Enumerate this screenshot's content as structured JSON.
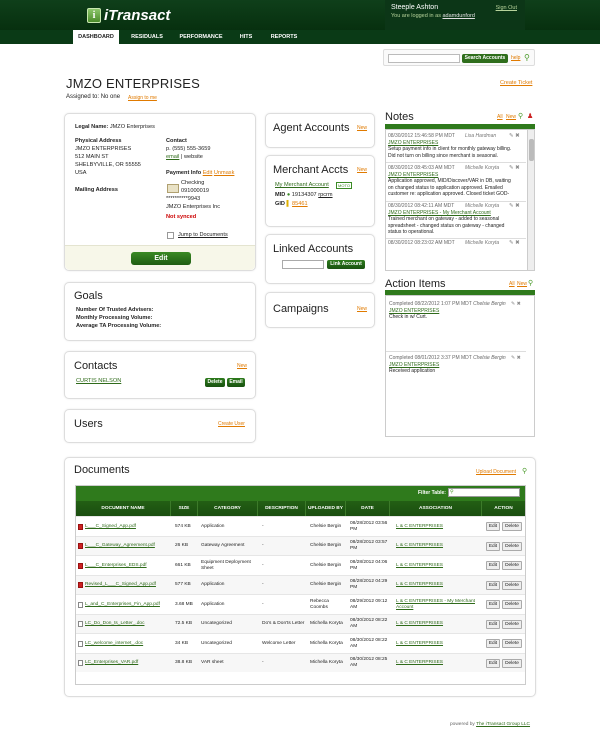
{
  "header": {
    "logo_mark": "i",
    "logo_text": "iTransact",
    "user_name": "Steeple Ashton",
    "logged_in_prefix": "You are logged in as",
    "logged_in_user": "adamdunford",
    "sign_out": "Sign Out"
  },
  "nav": [
    "DASHBOARD",
    "RESIDUALS",
    "PERFORMANCE",
    "HITS",
    "REPORTS"
  ],
  "search": {
    "button": "Search Accounts",
    "help": "help"
  },
  "merchant": {
    "title": "JMZO ENTERPRISES",
    "assigned": "Assigned to: No one",
    "assign_link": "Assign to me",
    "create_ticket": "Create Ticket"
  },
  "info": {
    "legal_name_label": "Legal Name:",
    "legal_name": "JMZO Enterprises",
    "physical_address_label": "Physical Address",
    "address_lines": [
      "JMZO ENTERPRISES",
      "512 MAIN ST",
      "SHELBYVILLE, OR 55555",
      "USA"
    ],
    "mailing_address_label": "Mailing Address",
    "contact_label": "Contact",
    "phone": "p. (555) 555-3659",
    "email_link": "email",
    "website_link": "website",
    "payment_label": "Payment Info",
    "edit_link": "Edit",
    "unmask_link": "Unmask",
    "not_synced": "Not synced",
    "payment_lines": [
      "Checking",
      "091000019",
      "**********9943",
      "JMZO Enterprises Inc"
    ],
    "jump": "Jump to Documents",
    "edit_button": "Edit"
  },
  "goals": {
    "title": "Goals",
    "rows": [
      "Number Of Trusted Advisers:",
      "Monthly Processing Volume:",
      "Average TA Processing Volume:"
    ]
  },
  "contacts": {
    "title": "Contacts",
    "new": "New",
    "name": "CURTIS NELSON",
    "delete": "Delete",
    "email": "Email"
  },
  "users": {
    "title": "Users",
    "create": "Create User"
  },
  "agent_accounts": {
    "title": "Agent Accounts",
    "new": "New"
  },
  "merchant_accts": {
    "title": "Merchant Accts",
    "new": "New",
    "account_link": "My Merchant Account",
    "badge": "MOTO",
    "mid_label": "MID",
    "mid_value": "19134307",
    "mid_link": "rpcrm",
    "gid_label": "GID",
    "gid_value": "85461"
  },
  "linked_accounts": {
    "title": "Linked Accounts",
    "button": "Link Account"
  },
  "campaigns": {
    "title": "Campaigns",
    "new": "New"
  },
  "notes": {
    "title": "Notes",
    "all": "All",
    "new": "New",
    "items": [
      {
        "date": "08/30/2012 15:46:58 PM MDT",
        "author": "Lisa Hardman",
        "link": "JMZO ENTERPRISES",
        "text": [
          "Setup payment info in client for monthly gateway billing.",
          "Did not turn on billing since merchant is seasonal."
        ]
      },
      {
        "date": "08/30/2012 08:45:03 AM MDT",
        "author": "Michelle Koryta",
        "link": "JMZO ENTERPRISES",
        "text": [
          "Application approved, MID/Discover/VAR in DB, waiting",
          "on changed status to application approved. Emailed",
          "customer re: application approved. Closed ticket GOD-"
        ]
      },
      {
        "date": "08/30/2012 08:42:11 AM MDT",
        "author": "Michelle Koryta",
        "link": "JMZO ENTERPRISES - My Merchant Account",
        "text": [
          "Trained merchant on gateway - added to seasonal",
          "spreadsheet - changed status on gateway - changed",
          "status to operational."
        ]
      },
      {
        "date": "08/30/2012 08:23:02 AM MDT",
        "author": "Michelle Koryta",
        "link": "",
        "text": []
      }
    ]
  },
  "action_items": {
    "title": "Action Items",
    "all": "All",
    "new": "New",
    "items": [
      {
        "completed": "Completed 08/22/2012 1:07 PM MDT",
        "author": "Chelsie Bergin",
        "link": "JMZO ENTERPRISES",
        "text": "Check in w/ Curt."
      },
      {
        "completed": "Completed 08/01/2012 3:37 PM MDT",
        "author": "Chelsie Bergin",
        "link": "JMZO ENTERPRISES",
        "text": "Received application"
      }
    ]
  },
  "documents": {
    "title": "Documents",
    "upload": "Upload Document",
    "filter_label": "Filter Table:",
    "columns": [
      "DOCUMENT NAME",
      "SIZE",
      "CATEGORY",
      "DESCRIPTION",
      "UPLOADED BY",
      "DATE",
      "ASSOCIATION",
      "ACTION"
    ],
    "edit": "Edit",
    "delete": "Delete",
    "rows": [
      {
        "name": "L___C_Signed_App.pdf",
        "pdf": true,
        "size": "574 KB",
        "category": "Application",
        "description": "-",
        "by": "Chelsie Bergin",
        "date": "08/28/2012 03:56 PM",
        "assoc": "L & C ENTERPRISES"
      },
      {
        "name": "L___C_Gateway_Agreement.pdf",
        "pdf": true,
        "size": "26 KB",
        "category": "Gateway Agreement",
        "description": "-",
        "by": "Chelsie Bergin",
        "date": "08/28/2012 03:57 PM",
        "assoc": "L & C ENTERPRISES"
      },
      {
        "name": "L___C_Enterprises_EDS.pdf",
        "pdf": true,
        "size": "661 KB",
        "category": "Equipment Deployment Sheet",
        "description": "-",
        "by": "Chelsie Bergin",
        "date": "08/28/2012 04:06 PM",
        "assoc": "L & C ENTERPRISES"
      },
      {
        "name": "Revised_L___C_Signed_App.pdf",
        "pdf": true,
        "size": "577 KB",
        "category": "Application",
        "description": "-",
        "by": "Chelsie Bergin",
        "date": "08/28/2012 04:29 PM",
        "assoc": "L & C ENTERPRISES"
      },
      {
        "name": "L_and_C_Enterprises_Fin_App.pdf",
        "pdf": false,
        "size": "3.68 MB",
        "category": "Application",
        "description": "-",
        "by": "Rebecca Coombs",
        "date": "08/29/2012 09:12 AM",
        "assoc": "L & C ENTERPRISES - My Merchant Account"
      },
      {
        "name": "LC_Do_Don_ts_Letter_.doc",
        "pdf": false,
        "size": "72.5 KB",
        "category": "Uncategorized",
        "description": "Do's & Don'ts Letter",
        "by": "Michella Koryta",
        "date": "08/30/2012 08:22 AM",
        "assoc": "L & C ENTERPRISES"
      },
      {
        "name": "LC_welcome_internet_.doc",
        "pdf": false,
        "size": "34 KB",
        "category": "Uncategorized",
        "description": "Welcome Letter",
        "by": "Michella Koryta",
        "date": "08/30/2012 08:22 AM",
        "assoc": "L & C ENTERPRISES"
      },
      {
        "name": "LC_Enterprises_VAR.pdf",
        "pdf": false,
        "size": "38.8 KB",
        "category": "VAR sheet",
        "description": "-",
        "by": "Michella Koryta",
        "date": "08/30/2012 08:25 AM",
        "assoc": "L & C ENTERPRISES"
      }
    ]
  },
  "footer": {
    "powered": "powered by",
    "company": "The iTransact Group LLC"
  }
}
